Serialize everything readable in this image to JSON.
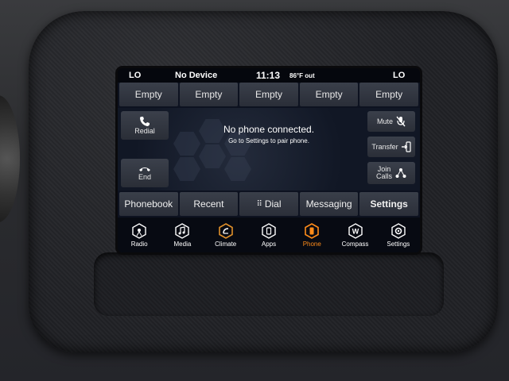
{
  "status": {
    "left_temp": "LO",
    "device": "No Device",
    "time": "11:13",
    "outside_temp": "86°F out",
    "right_temp": "LO"
  },
  "presets": [
    "Empty",
    "Empty",
    "Empty",
    "Empty",
    "Empty"
  ],
  "main": {
    "message_title": "No phone connected.",
    "message_sub": "Go to Settings to pair phone.",
    "redial_label": "Redial",
    "end_label": "End",
    "mute_label": "Mute",
    "transfer_label": "Transfer",
    "join_calls_label": "Join\nCalls"
  },
  "tabs": [
    "Phonebook",
    "Recent",
    "Dial",
    "Messaging",
    "Settings"
  ],
  "dock": [
    {
      "label": "Radio",
      "icon": "radio-icon"
    },
    {
      "label": "Media",
      "icon": "music-note-icon"
    },
    {
      "label": "Climate",
      "icon": "climate-icon"
    },
    {
      "label": "Apps",
      "icon": "apps-icon"
    },
    {
      "label": "Phone",
      "icon": "phone-icon",
      "active": true
    },
    {
      "label": "Compass",
      "icon": "compass-icon"
    },
    {
      "label": "Settings",
      "icon": "gear-icon"
    }
  ],
  "colors": {
    "accent_active": "#ff8c1a",
    "climate_accent": "#e0902a",
    "screen_bg": "#0d1220"
  }
}
